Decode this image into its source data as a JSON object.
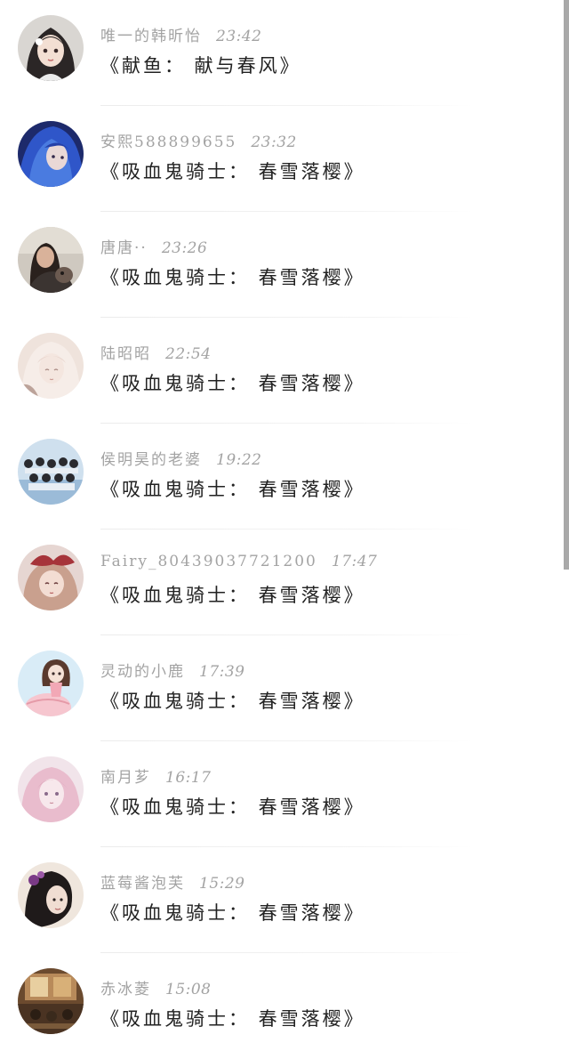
{
  "comments": [
    {
      "name": "唯一的韩昕怡",
      "time": "23:42",
      "title": "《献鱼： 献与春风》",
      "avatar": "anime-girl-avatar"
    },
    {
      "name": "安熙588899655",
      "time": "23:32",
      "title": "《吸血鬼骑士： 春雪落樱》",
      "avatar": "blue-hair-avatar"
    },
    {
      "name": "唐唐··",
      "time": "23:26",
      "title": "《吸血鬼骑士： 春雪落樱》",
      "avatar": "photo-girl-avatar"
    },
    {
      "name": "陆昭昭",
      "time": "22:54",
      "title": "《吸血鬼骑士： 春雪落樱》",
      "avatar": "pale-girl-avatar"
    },
    {
      "name": "侯明昊的老婆",
      "time": "19:22",
      "title": "《吸血鬼骑士： 春雪落樱》",
      "avatar": "group-photo-avatar"
    },
    {
      "name": "Fairy_80439037721200",
      "time": "17:47",
      "title": "《吸血鬼骑士： 春雪落樱》",
      "avatar": "red-bow-girl-avatar"
    },
    {
      "name": "灵动的小鹿",
      "time": "17:39",
      "title": "《吸血鬼骑士： 春雪落樱》",
      "avatar": "peach-girl-avatar"
    },
    {
      "name": "南月芗",
      "time": "16:17",
      "title": "《吸血鬼骑士： 春雪落樱》",
      "avatar": "pink-hair-avatar"
    },
    {
      "name": "蓝莓酱泡芙",
      "time": "15:29",
      "title": "《吸血鬼骑士： 春雪落樱》",
      "avatar": "flower-hair-avatar"
    },
    {
      "name": "赤冰菱",
      "time": "15:08",
      "title": "《吸血鬼骑士： 春雪落樱》",
      "avatar": "room-photo-avatar"
    }
  ],
  "colors": {
    "name_time": "#a3a3a3",
    "title": "#222222",
    "divider": "#ececec",
    "scrollbar": "#a9a9a9"
  }
}
